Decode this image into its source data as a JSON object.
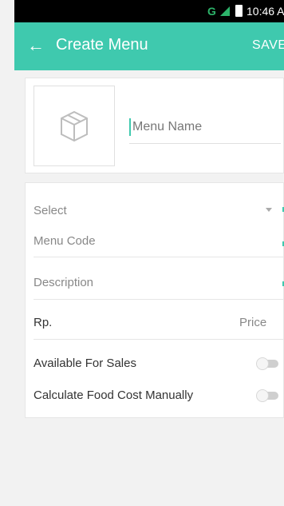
{
  "status_bar": {
    "network": "G",
    "time": "10:46 A"
  },
  "appbar": {
    "back_icon": "arrow-left-icon",
    "title": "Create Menu",
    "save_label": "SAVE"
  },
  "image_card": {
    "placeholder_icon": "box-icon",
    "menu_name_placeholder": "Menu Name"
  },
  "form": {
    "select_label": "Select",
    "menu_code_placeholder": "Menu Code",
    "description_placeholder": "Description",
    "currency": "Rp.",
    "price_placeholder": "Price",
    "available_label": "Available For Sales",
    "available_on": false,
    "food_cost_label": "Calculate Food Cost Manually",
    "food_cost_on": false
  },
  "colors": {
    "accent": "#3fc9ae",
    "background": "#f2f2f2"
  }
}
